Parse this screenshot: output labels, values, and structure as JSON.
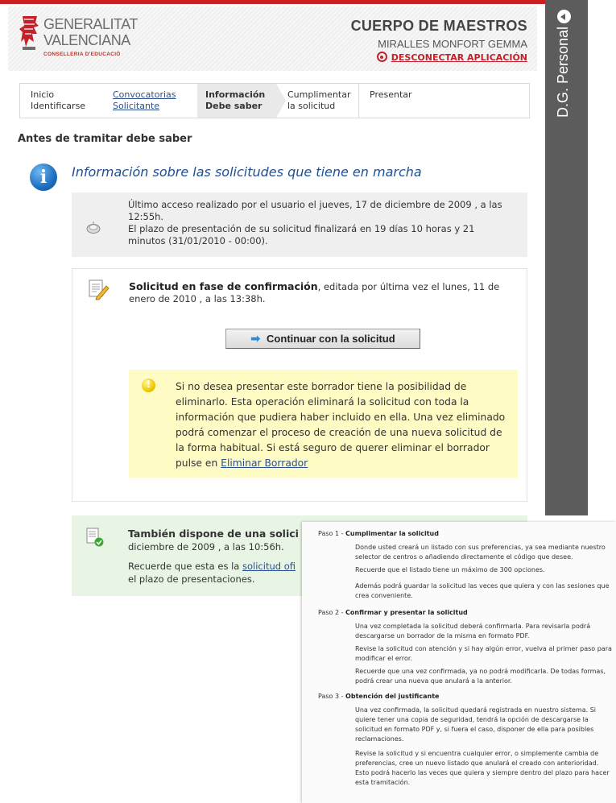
{
  "header": {
    "logo_line1": "GENERALITAT",
    "logo_line2": "VALENCIANA",
    "logo_line3": "CONSELLERIA D'EDUCACIÓ",
    "title": "CUERPO DE MAESTROS",
    "user": "MIRALLES MONFORT GEMMA",
    "logout": "DESCONECTAR APLICACIÓN"
  },
  "steps": [
    {
      "line1": "Inicio",
      "line2": "Identificarse"
    },
    {
      "line1": "Convocatorias",
      "line2": "Solicitante"
    },
    {
      "line1": "Información",
      "line2": "Debe saber"
    },
    {
      "line1": "Cumplimentar",
      "line2": "la solicitud"
    },
    {
      "line1": "Presentar",
      "line2": ""
    }
  ],
  "section_title": "Antes de tramitar debe saber",
  "info_heading": "Información sobre las solicitudes que tiene en marcha",
  "access": {
    "line1": "Último acceso realizado por el usuario el jueves, 17 de diciembre de 2009 , a las 12:55h.",
    "line2": "El plazo de presentación de su solicitud finalizará en 19 días 10 horas y 21 minutos (31/01/2010 - 00:00)."
  },
  "draft": {
    "title": "Solicitud en fase de confirmación",
    "rest": ", editada por última vez el lunes, 11 de enero de 2010 , a las 13:38h.",
    "button": "Continuar con la solicitud",
    "warning": "Si no desea presentar este borrador tiene la posibilidad de eliminarlo. Esta operación eliminará la solicitud con toda la información que pudiera haber incluido en ella. Una vez eliminado podrá comenzar el proceso de creación de una nueva solicitud de la forma habitual. Si está seguro de querer eliminar el borrador pulse en ",
    "warning_link": "Eliminar Borrador"
  },
  "also": {
    "title": "También dispone de una solici",
    "date": "diciembre de 2009 , a las 10:56h.",
    "text_before": "Recuerde que esta es la ",
    "link": "solicitud ofi",
    "text_after": "el plazo de presentaciones."
  },
  "sidebar": {
    "label": "D.G. Personal"
  },
  "popup": {
    "step1_prefix": "Paso 1 - ",
    "step1_title": "Cumplimentar la solicitud",
    "step1_p1": "Donde usted creará un listado con sus preferencias, ya sea mediante nuestro selector de centros o añadiendo directamente el código que desee.",
    "step1_p2": "Recuerde que el listado tiene un máximo de 300 opciones.",
    "step1_p3": "Además podrá guardar la solicitud las veces que quiera y con las sesiones que crea conveniente.",
    "step2_prefix": "Paso 2 - ",
    "step2_title": "Confirmar y presentar la solicitud",
    "step2_p1": "Una vez completada la solicitud deberá confirmarla. Para revisarla podrá descargarse un borrador de la misma en formato PDF.",
    "step2_p2": "Revise la solicitud con atención y si hay algún error, vuelva al primer paso para modificar el error.",
    "step2_p3": "Recuerde que una vez confirmada, ya no podrá modificarla. De todas formas, podrá crear una nueva que anulará a la anterior.",
    "step3_prefix": "Paso 3 - ",
    "step3_title": "Obtención del justificante",
    "step3_p1": "Una vez confirmada, la solicitud quedará registrada en nuestro sistema. Si quiere tener una copia de seguridad, tendrá la opción de descargarse la solicitud en formato PDF y, si fuera el caso, disponer de ella para posibles reclamaciones.",
    "step3_p2": "Revise la solicitud y si encuentra cualquier error, o simplemente cambia de preferencias, cree un nuevo listado que anulará el creado con anterioridad. Esto podrá hacerlo las veces que quiera y siempre dentro del plazo para hacer esta tramitación."
  },
  "colors": {
    "brand_red": "#cc1f1f",
    "link_blue": "#2a4f8f",
    "warning_bg": "#fffbc4",
    "success_bg": "#e8f5e4",
    "sidebar_bg": "#5c5c5c"
  }
}
